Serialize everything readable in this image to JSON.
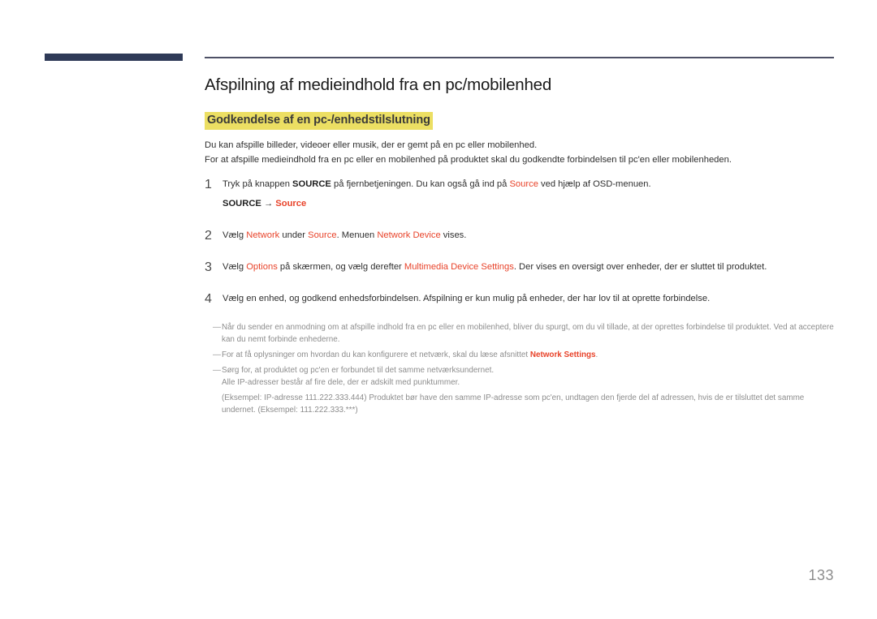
{
  "document": {
    "page_number": "133",
    "colors": {
      "accent_red": "#e8432a",
      "highlight_yellow": "#ecdf63",
      "navy_bar": "#2e3a57",
      "note_gray": "#8d8d8d"
    }
  },
  "heading": {
    "title": "Afspilning af medieindhold fra en pc/mobilenhed",
    "subtitle": "Godkendelse af en pc-/enhedstilslutning"
  },
  "intro": {
    "line1": "Du kan afspille billeder, videoer eller musik, der er gemt på en pc eller mobilenhed.",
    "line2": "For at afspille medieindhold fra en pc eller en mobilenhed på produktet skal du godkendte forbindelsen til pc'en eller mobilenheden."
  },
  "steps": [
    {
      "number": "1",
      "text_parts": {
        "t1": "Tryk på knappen ",
        "kw1": "SOURCE",
        "t2": " på fjernbetjeningen. Du kan også gå ind på ",
        "accent1": "Source",
        "t3": " ved hjælp af OSD-menuen."
      },
      "path": {
        "root": "SOURCE",
        "arrow": "→",
        "target": "Source"
      }
    },
    {
      "number": "2",
      "text_parts": {
        "t1": "Vælg ",
        "accent1": "Network",
        "t2": " under ",
        "accent2": "Source",
        "t3": ". Menuen ",
        "accent3": "Network Device",
        "t4": " vises."
      }
    },
    {
      "number": "3",
      "text_parts": {
        "t1": "Vælg ",
        "accent1": "Options",
        "t2": " på skærmen, og vælg derefter ",
        "accent2": "Multimedia Device Settings",
        "t3": ". Der vises en oversigt over enheder, der er sluttet til produktet."
      }
    },
    {
      "number": "4",
      "text_parts": {
        "t1": "Vælg en enhed, og godkend enhedsforbindelsen. Afspilning er kun mulig på enheder, der har lov til at oprette forbindelse."
      }
    }
  ],
  "notes": [
    {
      "dash": "―",
      "line1": "Når du sender en anmodning om at afspille indhold fra en pc eller en mobilenhed, bliver du spurgt, om du vil tillade, at der oprettes forbindelse til produktet. Ved at acceptere kan du nemt forbinde enhederne."
    },
    {
      "dash": "―",
      "line1_pre": "For at få oplysninger om hvordan du kan konfigurere et netværk, skal du læse afsnittet ",
      "line1_accent": "Network Settings",
      "line1_post": "."
    },
    {
      "dash": "―",
      "line1": "Sørg for, at produktet og pc'en er forbundet til det samme netværksundernet.",
      "line2": "Alle IP-adresser består af fire dele, der er adskilt med punktummer.",
      "line3": "(Eksempel: IP-adresse 111.222.333.444) Produktet bør have den samme IP-adresse som pc'en, undtagen den fjerde del af adressen, hvis de er tilsluttet det samme undernet. (Eksempel: 111.222.333.***)"
    }
  ]
}
